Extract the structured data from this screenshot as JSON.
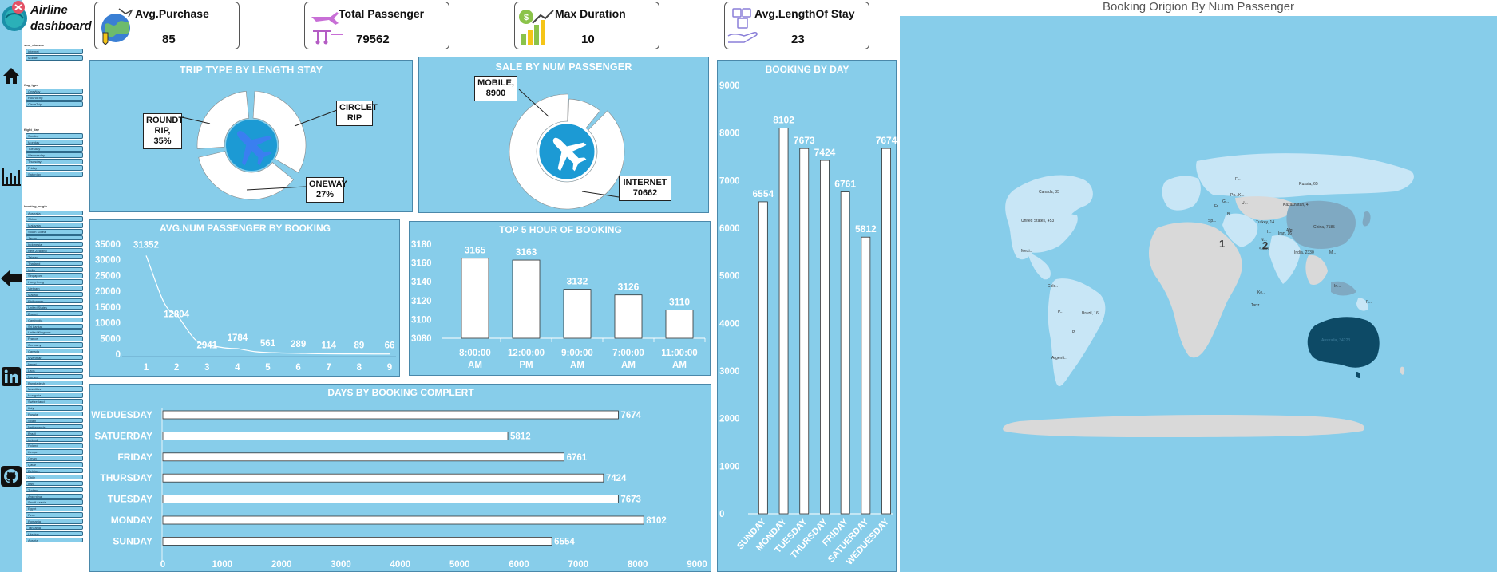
{
  "app": {
    "title": "Airline dashboard"
  },
  "rail": {
    "icons": [
      "home-icon",
      "bar-chart-icon",
      "back-arrow-icon",
      "linkedin-icon",
      "github-icon"
    ]
  },
  "slicers": [
    {
      "title": "seat_classes",
      "items": [
        "Internet",
        "Mobile"
      ]
    },
    {
      "title": "flag_type",
      "items": [
        "OneWay",
        "RoundTrip",
        "CircleTrip"
      ]
    },
    {
      "title": "flight_day",
      "items": [
        "Sunday",
        "Monday",
        "Tuesday",
        "Wednesday",
        "Thursday",
        "Friday",
        "Saturday"
      ]
    },
    {
      "title": "booking_origin",
      "items": [
        "Australia",
        "China",
        "Malaysia",
        "South Korea",
        "Japan",
        "Indonesia",
        "New Zealand",
        "Taiwan",
        "Thailand",
        "India",
        "Singapore",
        "Hong Kong",
        "Vietnam",
        "Macau",
        "Philippines",
        "United States",
        "Brunei",
        "Cambodia",
        "Sri Lanka",
        "United Kingdom",
        "France",
        "Germany",
        "Canada",
        "Myanmar",
        "Nepal",
        "Laos",
        "Norway",
        "Bangladesh",
        "Mauritius",
        "Mongolia",
        "Switzerland",
        "Italy",
        "Russia",
        "Spain",
        "Netherlands",
        "Brazil",
        "Ireland",
        "Poland",
        "Kenya",
        "Oman",
        "Qatar",
        "Belgium",
        "Chile",
        "Iran",
        "Turkey",
        "Argentina",
        "Saudi Arabia",
        "Egypt",
        "Peru",
        "Romania",
        "Tanzania",
        "Ukraine",
        "Austria"
      ]
    }
  ],
  "kpis": {
    "avg_purchase": {
      "label": "Avg.Purchase",
      "value": "85"
    },
    "total_passenger": {
      "label": "Total Passenger",
      "value": "79562"
    },
    "max_duration": {
      "label": "Max Duration",
      "value": "10"
    },
    "avg_length_of_stay": {
      "label": "Avg.LengthOf Stay",
      "value": "23"
    }
  },
  "trip_type": {
    "title": "TRIP TYPE BY LENGTH STAY",
    "callouts": {
      "round": "ROUNDT RIP, 35%",
      "circle": "CIRCLET RIP",
      "oneway": "ONEWAY 27%"
    }
  },
  "sale_channel": {
    "title": "SALE BY NUM PASSENGER",
    "callouts": {
      "mobile": "MOBILE, 8900",
      "internet": "INTERNET 70662"
    }
  },
  "colors": {
    "panel": "#87cdea",
    "panel_border": "#4a88aa",
    "bar_fill": "#ffffff",
    "map_ocean": "#87cdea",
    "map_land": "#d9d9d9",
    "map_low": "#c8e6f6",
    "map_mid": "#7fa9c2",
    "map_high": "#0d4a66"
  },
  "chart_data": [
    {
      "id": "avg_num_passenger",
      "type": "line",
      "title": "AVG.NUM PASSENGER BY BOOKING",
      "x": [
        "1",
        "2",
        "3",
        "4",
        "5",
        "6",
        "7",
        "8",
        "9"
      ],
      "values": [
        31352,
        12804,
        2941,
        1784,
        561,
        289,
        114,
        89,
        66
      ],
      "yticks": [
        "0",
        "5000",
        "10000",
        "15000",
        "20000",
        "25000",
        "30000",
        "35000"
      ],
      "ylim": [
        0,
        35000
      ]
    },
    {
      "id": "top5_hour",
      "type": "bar",
      "title": "TOP 5 HOUR OF BOOKING",
      "categories": [
        "8:00:00 AM",
        "12:00:00 PM",
        "9:00:00 AM",
        "7:00:00 AM",
        "11:00:00 AM"
      ],
      "values": [
        3165,
        3163,
        3132,
        3126,
        3110
      ],
      "yticks": [
        "3080",
        "3100",
        "3120",
        "3140",
        "3160",
        "3180"
      ],
      "ylim": [
        3080,
        3180
      ]
    },
    {
      "id": "days_by_booking_complete",
      "type": "bar",
      "orientation": "horizontal",
      "title": "DAYS BY BOOKING COMPLERT",
      "categories": [
        "WEDUESDAY",
        "SATUERDAY",
        "FRIDAY",
        "THURSDAY",
        "TUESDAY",
        "MONDAY",
        "SUNDAY"
      ],
      "values": [
        7674,
        5812,
        6761,
        7424,
        7673,
        8102,
        6554
      ],
      "xticks": [
        "0",
        "1000",
        "2000",
        "3000",
        "4000",
        "5000",
        "6000",
        "7000",
        "8000",
        "9000"
      ],
      "xlim": [
        0,
        9000
      ]
    },
    {
      "id": "booking_by_day",
      "type": "bar",
      "title": "BOOKING BY DAY",
      "categories": [
        "SUNDAY",
        "MONDAY",
        "TUESDAY",
        "THURSDAY",
        "FRIDAY",
        "SATUERDAY",
        "WEDUESDAY"
      ],
      "values": [
        6554,
        8102,
        7673,
        7424,
        6761,
        5812,
        7674
      ],
      "yticks": [
        "0",
        "1000",
        "2000",
        "3000",
        "4000",
        "5000",
        "6000",
        "7000",
        "8000",
        "9000"
      ],
      "ylim": [
        0,
        9000
      ]
    },
    {
      "id": "trip_type_donut",
      "type": "pie",
      "title": "TRIP TYPE BY LENGTH STAY",
      "categories": [
        "ROUNDT RIP",
        "CIRCLET RIP",
        "ONEWAY"
      ],
      "values": [
        35,
        38,
        27
      ]
    },
    {
      "id": "sale_donut",
      "type": "pie",
      "title": "SALE BY NUM PASSENGER",
      "categories": [
        "MOBILE",
        "INTERNET"
      ],
      "values": [
        8900,
        70662
      ]
    }
  ],
  "map": {
    "title": "Booking Origion By Num Passenger",
    "cluster_labels": [
      "1",
      "2"
    ],
    "country_labels": [
      "Canada, 85",
      "United States, 453",
      "Mexi..",
      "Colo..",
      "P...",
      "Brazil, 16",
      "P...",
      "Argenti..",
      "Russia, 65",
      "Kazakhstan, 4",
      "Turkey, 14",
      "I...",
      "Iran, 16",
      "Afg..",
      "China, 7185",
      "India, 2330",
      "Saudi..",
      "Ke..",
      "Tanz..",
      "Australia, 34223",
      "P...",
      "F...",
      "U...",
      "G...",
      "Po...",
      "K...",
      "Fr...",
      "Sp...",
      "B...",
      "N...",
      "M...",
      "In..."
    ]
  }
}
